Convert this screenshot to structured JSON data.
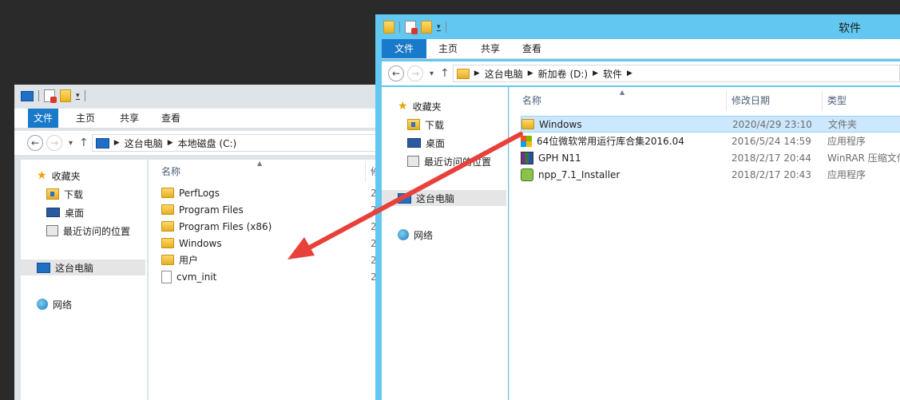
{
  "left_window": {
    "ribbon_tabs": [
      "文件",
      "主页",
      "共享",
      "查看"
    ],
    "breadcrumb": [
      "这台电脑",
      "本地磁盘 (C:)"
    ],
    "nav": {
      "favorites": "收藏夹",
      "downloads": "下载",
      "desktop": "桌面",
      "recent": "最近访问的位置",
      "this_pc": "这台电脑",
      "network": "网络"
    },
    "columns": {
      "name": "名称",
      "date": "修"
    },
    "files": [
      {
        "name": "PerfLogs",
        "icon": "folder-icon",
        "date_partial": "2"
      },
      {
        "name": "Program Files",
        "icon": "folder-icon",
        "date_partial": "2"
      },
      {
        "name": "Program Files (x86)",
        "icon": "folder-icon",
        "date_partial": "2"
      },
      {
        "name": "Windows",
        "icon": "folder-icon",
        "date_partial": "2"
      },
      {
        "name": "用户",
        "icon": "folder-icon",
        "date_partial": "2"
      },
      {
        "name": "cvm_init",
        "icon": "file-icon",
        "date_partial": "2"
      }
    ]
  },
  "right_window": {
    "title": "软件",
    "ribbon_tabs": [
      "文件",
      "主页",
      "共享",
      "查看"
    ],
    "breadcrumb": [
      "这台电脑",
      "新加卷 (D:)",
      "软件"
    ],
    "nav": {
      "favorites": "收藏夹",
      "downloads": "下载",
      "desktop": "桌面",
      "recent": "最近访问的位置",
      "this_pc": "这台电脑",
      "network": "网络"
    },
    "columns": {
      "name": "名称",
      "date": "修改日期",
      "type": "类型"
    },
    "files": [
      {
        "name": "Windows",
        "date": "2020/4/29 23:10",
        "type": "文件夹",
        "icon": "folder-icon"
      },
      {
        "name": "64位微软常用运行库合集2016.04",
        "date": "2016/5/24 14:59",
        "type": "应用程序",
        "icon": "app-installer-icon"
      },
      {
        "name": "GPH N11",
        "date": "2018/2/17 20:44",
        "type": "WinRAR 压缩文件",
        "icon": "winrar-archive-icon"
      },
      {
        "name": "npp_7.1_Installer",
        "date": "2018/2/17 20:43",
        "type": "应用程序",
        "icon": "notepadpp-icon"
      }
    ]
  },
  "colors": {
    "right_titlebar": "#62c7f1",
    "left_titlebar": "#dfe4e8",
    "file_tab": "#1979ca",
    "selection": "#cce8ff",
    "arrow": "#e8403a"
  }
}
